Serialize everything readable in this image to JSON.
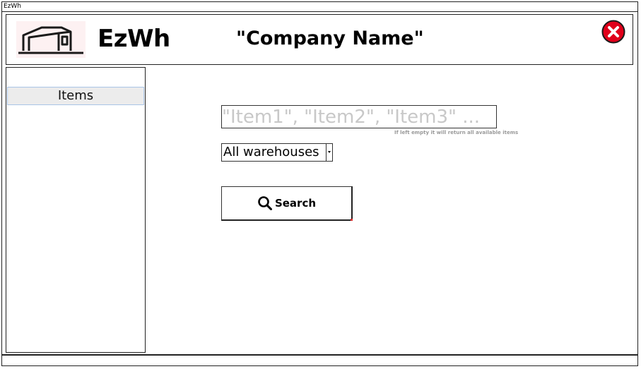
{
  "window": {
    "title": "EzWh"
  },
  "header": {
    "app_name": "EzWh",
    "company_name": "\"Company Name\"",
    "logo_icon": "warehouse-icon",
    "close_icon": "close-icon",
    "close_color": "#e0001a"
  },
  "sidebar": {
    "items": [
      {
        "label": "Items",
        "selected": true
      }
    ]
  },
  "search": {
    "value": "",
    "placeholder": "\"Item1\", \"Item2\", \"Item3\" ...",
    "hint": "If left empty it will return all available items",
    "warehouse_selected": "All warehouses",
    "button_label": "Search",
    "button_icon": "search-icon"
  }
}
